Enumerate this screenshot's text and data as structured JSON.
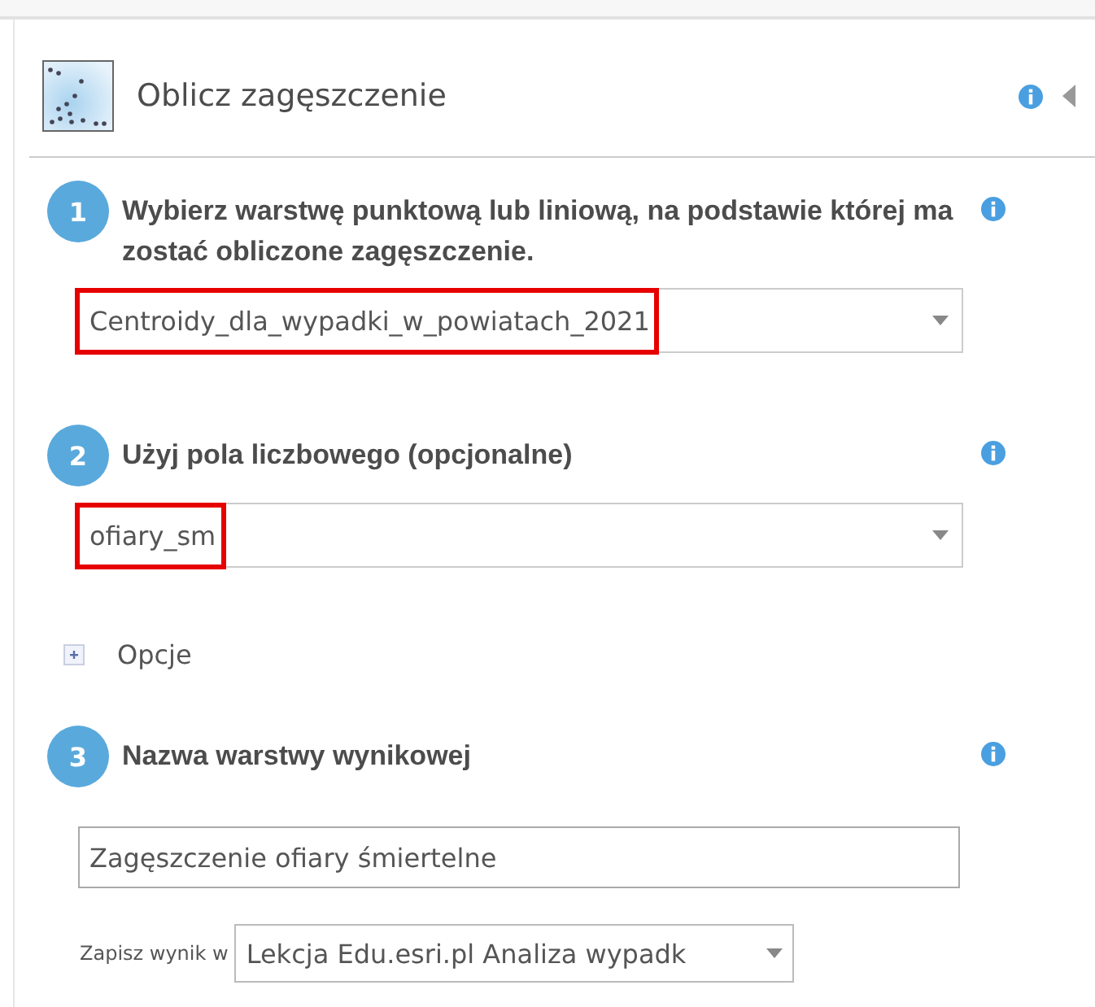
{
  "panel": {
    "title": "Oblicz zagęszczenie"
  },
  "steps": [
    {
      "number": "1",
      "label": "Wybierz warstwę punktową lub liniową, na podstawie której ma zostać obliczone zagęszczenie.",
      "kind": "select",
      "value": "Centroidy_dla_wypadki_w_powiatach_2021",
      "highlighted": true
    },
    {
      "number": "2",
      "label": "Użyj pola liczbowego (opcjonalne)",
      "kind": "select",
      "value": "ofiary_sm",
      "highlighted": true
    },
    {
      "kind": "options",
      "label": "Opcje",
      "expanded": false
    },
    {
      "number": "3",
      "label": "Nazwa warstwy wynikowej",
      "kind": "text",
      "value": "Zagęszczenie ofiary śmiertelne",
      "save": {
        "label": "Zapisz wynik w",
        "value": "Lekcja Edu.esri.pl Analiza wypadk"
      }
    }
  ]
}
